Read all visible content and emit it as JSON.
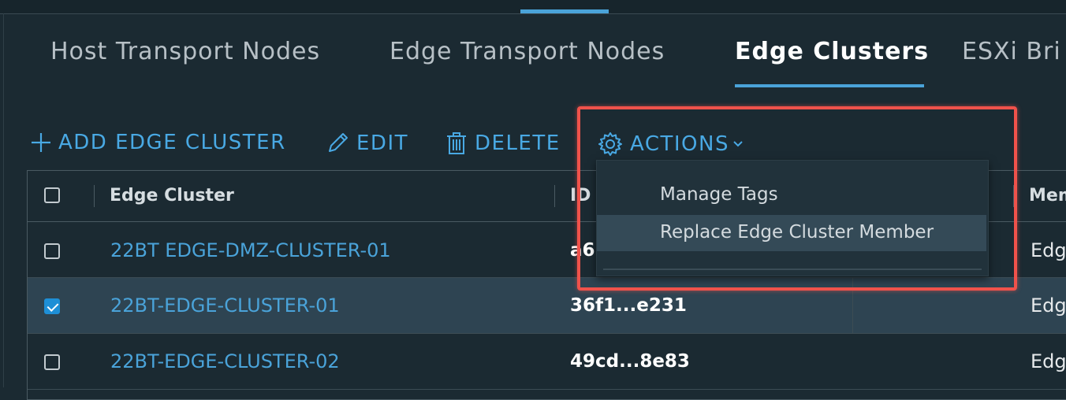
{
  "tabs": [
    {
      "label": "Host Transport Nodes",
      "active": false
    },
    {
      "label": "Edge Transport Nodes",
      "active": false
    },
    {
      "label": "Edge Clusters",
      "active": true
    },
    {
      "label": "ESXi Bri",
      "active": false
    }
  ],
  "toolbar": {
    "add_label": "ADD EDGE CLUSTER",
    "edit_label": "EDIT",
    "delete_label": "DELETE",
    "actions_label": "ACTIONS"
  },
  "actions_menu": {
    "items": [
      {
        "label": "Manage Tags"
      },
      {
        "label": "Replace Edge Cluster Member"
      }
    ]
  },
  "table": {
    "columns": [
      "Edge Cluster",
      "ID",
      "Mem"
    ],
    "rows": [
      {
        "name": "22BT EDGE-DMZ-CLUSTER-01",
        "id": "a6",
        "member": "Edg",
        "selected": false
      },
      {
        "name": "22BT-EDGE-CLUSTER-01",
        "id": "36f1...e231",
        "member": "Edg",
        "selected": true
      },
      {
        "name": "22BT-EDGE-CLUSTER-02",
        "id": "49cd...8e83",
        "member": "Edg",
        "selected": false
      }
    ]
  },
  "colors": {
    "background": "#1b2a32",
    "accent": "#4aa3d9",
    "highlight": "#f0524b",
    "selected_row": "#2e4452"
  },
  "icons": [
    "plus-icon",
    "pencil-icon",
    "trash-icon",
    "gear-icon",
    "chevron-down-icon"
  ]
}
